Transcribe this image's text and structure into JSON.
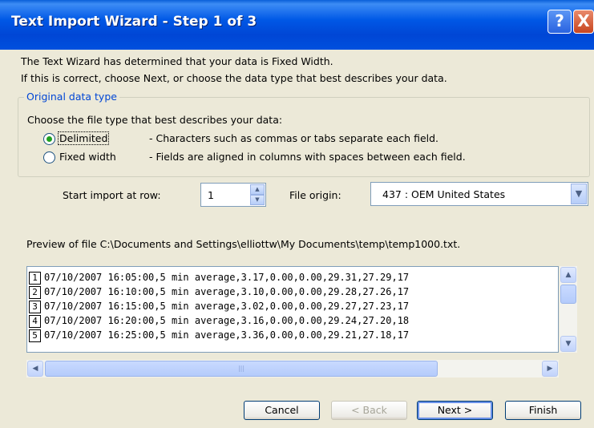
{
  "window": {
    "title": "Text Import Wizard - Step 1 of 3",
    "help_label": "?",
    "close_label": "X"
  },
  "intro": {
    "line1": "The Text Wizard has determined that your data is Fixed Width.",
    "line2": "If this is correct, choose Next, or choose the data type that best describes your data."
  },
  "original_data_type": {
    "legend": "Original data type",
    "prompt": "Choose the file type that best describes your data:",
    "options": [
      {
        "label": "Delimited",
        "description": "- Characters such as commas or tabs separate each field.",
        "selected": true
      },
      {
        "label": "Fixed width",
        "description": "- Fields are aligned in columns with spaces between each field.",
        "selected": false
      }
    ]
  },
  "start_row": {
    "label": "Start import at row:",
    "value": "1"
  },
  "file_origin": {
    "label": "File origin:",
    "value": "437 : OEM United States"
  },
  "preview": {
    "label": "Preview of file C:\\Documents and Settings\\elliottw\\My Documents\\temp\\temp1000.txt.",
    "rows": [
      {
        "num": "1",
        "text": "07/10/2007 16:05:00,5 min average,3.17,0.00,0.00,29.31,27.29,17"
      },
      {
        "num": "2",
        "text": "07/10/2007 16:10:00,5 min average,3.10,0.00,0.00,29.28,27.26,17"
      },
      {
        "num": "3",
        "text": "07/10/2007 16:15:00,5 min average,3.02,0.00,0.00,29.27,27.23,17"
      },
      {
        "num": "4",
        "text": "07/10/2007 16:20:00,5 min average,3.16,0.00,0.00,29.24,27.20,18"
      },
      {
        "num": "5",
        "text": "07/10/2007 16:25:00,5 min average,3.36,0.00,0.00,29.21,27.18,17"
      }
    ]
  },
  "buttons": {
    "cancel": "Cancel",
    "back": "< Back",
    "next": "Next >",
    "finish": "Finish"
  },
  "icons": {
    "spin_up": "▲",
    "spin_down": "▼",
    "dropdown": "▼",
    "scroll_up": "▲",
    "scroll_down": "▼",
    "scroll_left": "◀",
    "scroll_right": "▶",
    "grip": "|||"
  },
  "colors": {
    "title_bar": "#0050de",
    "legend": "#0046d5",
    "radio_dot": "#21a121",
    "face": "#ece9d8"
  }
}
